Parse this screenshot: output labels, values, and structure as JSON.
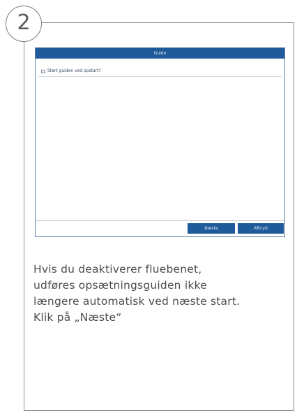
{
  "step": {
    "number": "2"
  },
  "screenshot": {
    "dialog_title": "Guide",
    "checkbox_label": "Start guiden ved opstart?",
    "checkbox_checked": false,
    "buttons": {
      "next_label": "Næste",
      "cancel_label": "Afbryd"
    },
    "colors": {
      "title_bar": "#1f5b9a",
      "button": "#1f5b9a"
    }
  },
  "caption": {
    "lines": [
      "Hvis du deaktiverer fluebenet,",
      "udføres opsætningsguiden ikke",
      "længere automatisk ved næste start.",
      "Klik på „Næste“"
    ]
  }
}
